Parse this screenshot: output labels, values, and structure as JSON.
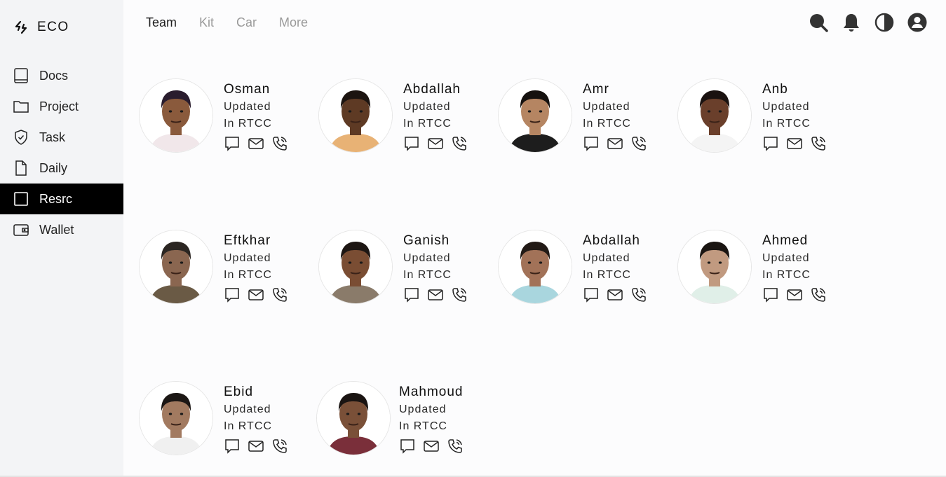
{
  "app": {
    "brand": "ECO"
  },
  "sidebar": {
    "items": [
      {
        "label": "Docs",
        "icon": "book-icon",
        "active": false
      },
      {
        "label": "Project",
        "icon": "folder-icon",
        "active": false
      },
      {
        "label": "Task",
        "icon": "shield-check-icon",
        "active": false
      },
      {
        "label": "Daily",
        "icon": "document-icon",
        "active": false
      },
      {
        "label": "Resrc",
        "icon": "square-icon",
        "active": true
      },
      {
        "label": "Wallet",
        "icon": "wallet-icon",
        "active": false
      }
    ]
  },
  "topnav": {
    "tabs": [
      {
        "label": "Team",
        "active": true
      },
      {
        "label": "Kit",
        "active": false
      },
      {
        "label": "Car",
        "active": false
      },
      {
        "label": "More",
        "active": false
      }
    ]
  },
  "toolbar": {
    "icons": [
      "search-icon",
      "bell-icon",
      "theme-toggle-icon",
      "account-icon"
    ]
  },
  "team": {
    "members": [
      {
        "name": "Osman",
        "status": "Updated",
        "location": "In RTCC",
        "skin": "#8a5a3c",
        "hair": "#2a1d2e",
        "shirt": "#f1e7ea"
      },
      {
        "name": "Abdallah",
        "status": "Updated",
        "location": "In RTCC",
        "skin": "#5e3a24",
        "hair": "#1c1410",
        "shirt": "#e8b275"
      },
      {
        "name": "Amr",
        "status": "Updated",
        "location": "In RTCC",
        "skin": "#b58562",
        "hair": "#15110f",
        "shirt": "#1d1d1d"
      },
      {
        "name": "Anb",
        "status": "Updated",
        "location": "In RTCC",
        "skin": "#6a3f2b",
        "hair": "#1a1210",
        "shirt": "#f4f4f4"
      },
      {
        "name": "Eftkhar",
        "status": "Updated",
        "location": "In RTCC",
        "skin": "#8a6650",
        "hair": "#2b2622",
        "shirt": "#6a5a45"
      },
      {
        "name": "Ganish",
        "status": "Updated",
        "location": "In RTCC",
        "skin": "#7a4d33",
        "hair": "#1d1613",
        "shirt": "#8a7b6a"
      },
      {
        "name": "Abdallah",
        "status": "Updated",
        "location": "In RTCC",
        "skin": "#a27258",
        "hair": "#221a16",
        "shirt": "#a9d6de"
      },
      {
        "name": "Ahmed",
        "status": "Updated",
        "location": "In RTCC",
        "skin": "#c19a80",
        "hair": "#1a1512",
        "shirt": "#e0efe8"
      },
      {
        "name": "Ebid",
        "status": "Updated",
        "location": "In RTCC",
        "skin": "#a27a60",
        "hair": "#1c1715",
        "shirt": "#f0f0f0"
      },
      {
        "name": "Mahmoud",
        "status": "Updated",
        "location": "In RTCC",
        "skin": "#7a5038",
        "hair": "#1a1412",
        "shirt": "#7a2f3a"
      }
    ]
  }
}
